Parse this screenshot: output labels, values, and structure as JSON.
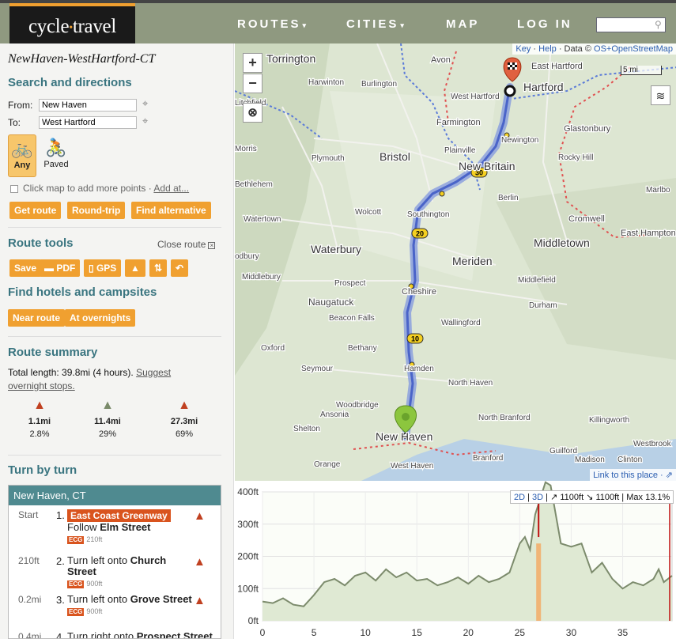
{
  "header": {
    "logo_left": "cycle",
    "logo_right": "travel",
    "nav": [
      {
        "label": "ROUTES",
        "caret": "▾"
      },
      {
        "label": "CITIES",
        "caret": "▾"
      },
      {
        "label": "MAP",
        "caret": ""
      },
      {
        "label": "LOG IN",
        "caret": ""
      }
    ],
    "search_placeholder": ""
  },
  "sidebar": {
    "route_title": "NewHaven-WestHartford-CT",
    "search_heading": "Search and directions",
    "from_label": "From:",
    "from_value": "New Haven",
    "to_label": "To:",
    "to_value": "West Hartford",
    "bike_options": [
      {
        "label": "Any",
        "selected": true
      },
      {
        "label": "Paved",
        "selected": false
      }
    ],
    "add_points_text": "Click map to add more points · ",
    "add_at_link": "Add at...",
    "actions": [
      "Get route",
      "Round-trip",
      "Find alternative"
    ],
    "route_tools_heading": "Route tools",
    "close_route": "Close route",
    "tools": [
      "Save",
      "PDF",
      "GPS",
      "",
      "",
      ""
    ],
    "hotels_heading": "Find hotels and campsites",
    "hotels_buttons": [
      "Near route",
      "At overnights"
    ],
    "summary_heading": "Route summary",
    "summary_text": "Total length: 39.8mi (4 hours). ",
    "summary_link": "Suggest overnight stops.",
    "road_types": [
      {
        "distance": "1.1mi",
        "percent": "2.8%",
        "color": "#c04020"
      },
      {
        "distance": "11.4mi",
        "percent": "29%",
        "color": "#7a8a6a"
      },
      {
        "distance": "27.3mi",
        "percent": "69%",
        "color": "#c04020"
      }
    ],
    "turn_heading": "Turn by turn",
    "turn_box_title": "New Haven, CT",
    "turns": [
      {
        "dist": "Start",
        "num": "1.",
        "tag": "East Coast Greenway",
        "text": "Follow ",
        "bold": "Elm Street",
        "mini": "ECG",
        "mini_dist": "210ft"
      },
      {
        "dist": "210ft",
        "num": "2.",
        "tag": "",
        "text": "Turn left onto ",
        "bold": "Church Street",
        "mini": "ECG",
        "mini_dist": "900ft"
      },
      {
        "dist": "0.2mi",
        "num": "3.",
        "tag": "",
        "text": "Turn left onto ",
        "bold": "Grove Street",
        "mini": "ECG",
        "mini_dist": "900ft"
      },
      {
        "dist": "0.4mi",
        "num": "4.",
        "tag": "",
        "text": "Turn right onto ",
        "bold": "Prospect Street",
        "mini": "",
        "mini_dist": ""
      }
    ]
  },
  "map": {
    "attribution_key": "Key",
    "attribution_help": "Help",
    "attribution_data": "Data ©",
    "attribution_osm": "OS+OpenStreetMap",
    "scale_label": "5 mi",
    "link_here": "Link to this place · ",
    "zoom_in": "+",
    "zoom_out": "−",
    "towns": [
      "Torrington",
      "Avon",
      "East Hartford",
      "Hartford",
      "Harwinton",
      "Burlington",
      "West Hartford",
      "Litchfield",
      "Farmington",
      "Glastonbury",
      "Newington",
      "Morris",
      "Bristol",
      "Plainville",
      "Plymouth",
      "Rocky Hill",
      "New Britain",
      "Bethlehem",
      "Berlin",
      "Marlbo",
      "Watertown",
      "Wolcott",
      "Southington",
      "Cromwell",
      "East Hampton",
      "Waterbury",
      "Middletown",
      "odbury",
      "Meriden",
      "Middlebury",
      "Prospect",
      "Cheshire",
      "Middlefield",
      "Naugatuck",
      "Durham",
      "Beacon Falls",
      "Wallingford",
      "Oxford",
      "Bethany",
      "Seymour",
      "Hamden",
      "North Haven",
      "Woodbridge",
      "Killingworth",
      "Ansonia",
      "North Branford",
      "Shelton",
      "New Haven",
      "Guilford",
      "Westbrook",
      "Orange",
      "Branford",
      "Madison",
      "Clinton",
      "West Haven"
    ],
    "road_shields": [
      "30",
      "20",
      "10"
    ]
  },
  "elevation": {
    "mode_2d": "2D",
    "mode_3d": "3D",
    "ascent": "↗ 1100ft",
    "descent": "↘ 1100ft",
    "max_grade": "Max 13.1%",
    "y_ticks": [
      "400ft",
      "300ft",
      "200ft",
      "100ft",
      "0ft"
    ],
    "x_ticks": [
      "0",
      "5",
      "10",
      "15",
      "20",
      "25",
      "30",
      "35"
    ]
  },
  "chart_data": {
    "type": "area",
    "xlabel": "",
    "ylabel": "",
    "xlim": [
      0,
      39.8
    ],
    "ylim": [
      0,
      400
    ],
    "x": [
      0,
      1,
      2,
      3,
      4,
      5,
      6,
      7,
      8,
      9,
      10,
      11,
      12,
      13,
      14,
      15,
      16,
      17,
      18,
      19,
      20,
      21,
      22,
      23,
      24,
      25,
      25.5,
      26,
      26.5,
      27,
      27.5,
      28,
      29,
      30,
      31,
      32,
      33,
      34,
      35,
      36,
      37,
      38,
      38.5,
      39,
      39.8
    ],
    "y": [
      60,
      55,
      70,
      50,
      45,
      80,
      120,
      130,
      110,
      140,
      150,
      125,
      160,
      135,
      150,
      125,
      130,
      110,
      120,
      135,
      115,
      140,
      120,
      130,
      150,
      240,
      260,
      220,
      330,
      380,
      450,
      420,
      240,
      230,
      240,
      150,
      180,
      130,
      100,
      120,
      110,
      130,
      160,
      120,
      140
    ],
    "grid": true,
    "colors": {
      "fill": "#dfe9d3",
      "line": "#7c8b6c",
      "highlight": "#c01010"
    }
  },
  "colors": {
    "accent": "#f0a030",
    "brand_dark": "#1a1a1a",
    "header": "#8f9980",
    "heading": "#3a7580",
    "route": "#6f86d8",
    "ecg": "#d9541e"
  }
}
